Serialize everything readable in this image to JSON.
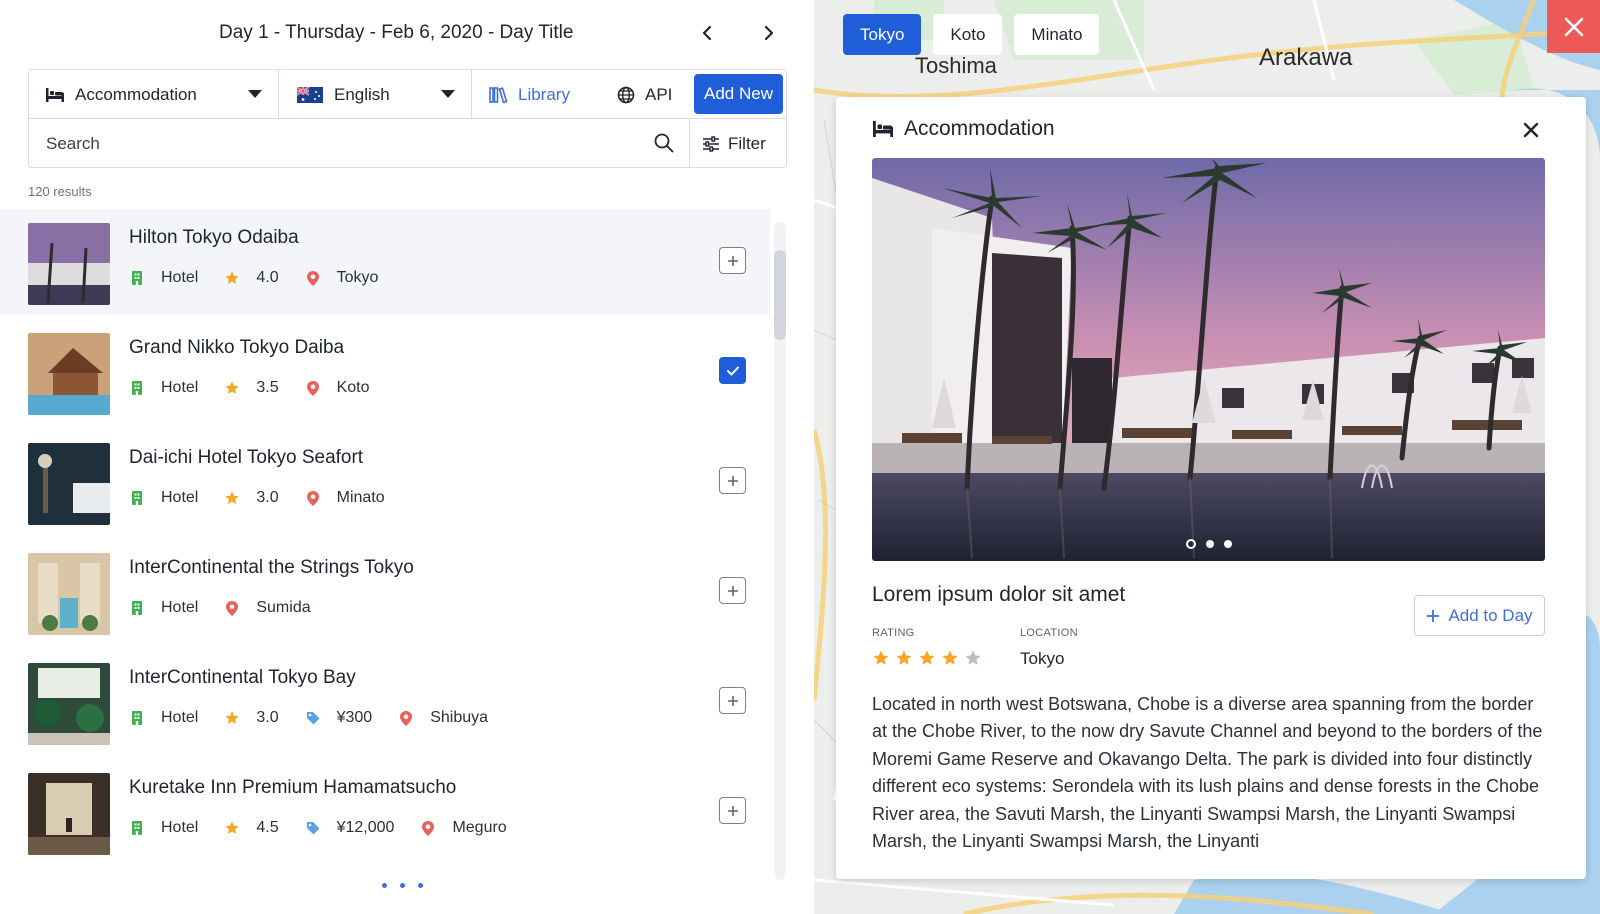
{
  "header": {
    "day_title": "Day 1 - Thursday - Feb 6, 2020 - Day Title"
  },
  "toolbar": {
    "category_label": "Accommodation",
    "language_label": "English",
    "library_label": "Library",
    "api_label": "API",
    "add_new_label": "Add New",
    "search_placeholder": "Search",
    "filter_label": "Filter"
  },
  "results_count": "120 results",
  "items": [
    {
      "name": "Hilton Tokyo Odaiba",
      "type": "Hotel",
      "rating": "4.0",
      "price": "",
      "location": "Tokyo",
      "added": false
    },
    {
      "name": "Grand Nikko Tokyo Daiba",
      "type": "Hotel",
      "rating": "3.5",
      "price": "",
      "location": "Koto",
      "added": true
    },
    {
      "name": "Dai-ichi Hotel Tokyo Seafort",
      "type": "Hotel",
      "rating": "3.0",
      "price": "",
      "location": "Minato",
      "added": false
    },
    {
      "name": "InterContinental the Strings Tokyo",
      "type": "Hotel",
      "rating": "",
      "price": "",
      "location": "Sumida",
      "added": false
    },
    {
      "name": "InterContinental Tokyo Bay",
      "type": "Hotel",
      "rating": "3.0",
      "price": "¥300",
      "location": "Shibuya",
      "added": false
    },
    {
      "name": "Kuretake Inn Premium Hamamatsucho",
      "type": "Hotel",
      "rating": "4.5",
      "price": "¥12,000",
      "location": "Meguro",
      "added": false
    }
  ],
  "map": {
    "labels": {
      "toshima": "Toshima",
      "arakawa": "Arakawa"
    },
    "chips": [
      "Tokyo",
      "Koto",
      "Minato"
    ],
    "active_chip": "Tokyo"
  },
  "detail": {
    "category": "Accommodation",
    "title": "Lorem ipsum dolor sit amet",
    "add_to_day_label": "Add to Day",
    "rating_label": "RATING",
    "rating_value": 4,
    "rating_max": 5,
    "location_label": "LOCATION",
    "location_value": "Tokyo",
    "description": "Located in north west Botswana, Chobe is a diverse area spanning from the border at the Chobe River, to the now dry Savute Channel and beyond to the borders of the Moremi Game Reserve and Okavango Delta. The park is divided into four distinctly different eco systems: Serondela with its lush plains and dense forests in the Chobe River area, the Savuti Marsh, the Linyanti Swampsi Marsh, the Linyanti Swampsi Marsh, the Linyanti Swampsi Marsh, the Linyanti",
    "image_count": 3,
    "active_image": 1
  },
  "colors": {
    "accent": "#1f5ed8",
    "link": "#3f6fd8",
    "close_bg": "#ec5a57",
    "star": "#f5a623",
    "hotel_icon": "#3fb24f",
    "pin_icon": "#e8625a",
    "price_icon": "#5aa0e6"
  }
}
